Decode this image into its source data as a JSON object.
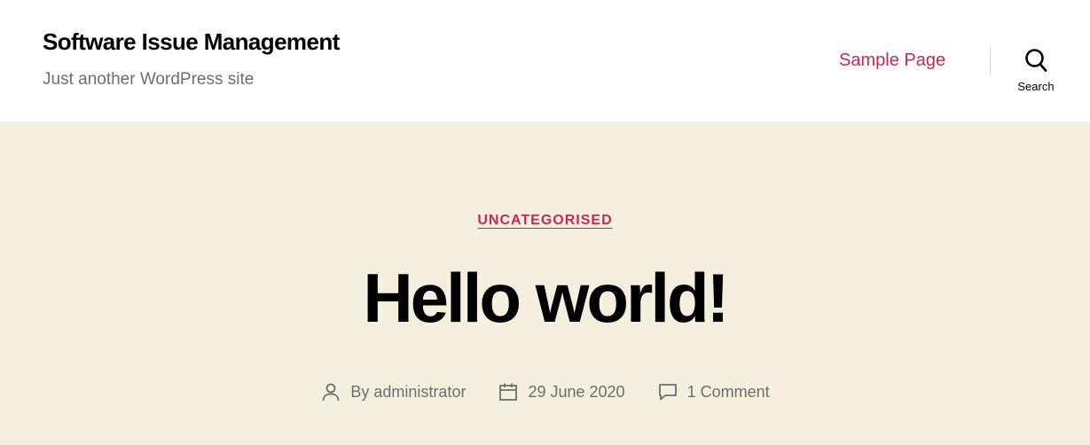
{
  "header": {
    "site_title": "Software Issue Management",
    "site_description": "Just another WordPress site",
    "nav": [
      {
        "label": "Sample Page"
      }
    ],
    "search_label": "Search"
  },
  "post": {
    "category": "UNCATEGORISED",
    "title": "Hello world!",
    "meta": {
      "author_prefix": "By ",
      "author": "administrator",
      "date": "29 June 2020",
      "comments": "1 Comment"
    }
  },
  "colors": {
    "accent": "#cd2653",
    "hero_background": "#f5efe0",
    "header_background": "#ffffff",
    "secondary_text": "#6d6d6d"
  },
  "icons": {
    "search": "search-icon",
    "author": "user-icon",
    "date": "calendar-icon",
    "comments": "comment-icon"
  }
}
